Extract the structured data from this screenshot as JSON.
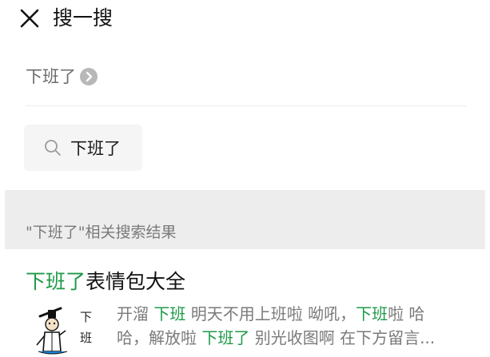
{
  "header": {
    "title": "搜一搜",
    "close_icon": "close-icon"
  },
  "query": {
    "text": "下班了",
    "arrow_icon": "chevron-right-icon"
  },
  "search_chip": {
    "icon": "search-icon",
    "text": "下班了"
  },
  "related": {
    "label": "\"下班了\"相关搜索结果"
  },
  "result": {
    "title_highlight": "下班了",
    "title_rest": "表情包大全",
    "thumbnail_chars": [
      "下",
      "班"
    ],
    "snippet": {
      "line1": [
        {
          "text": "开溜 ",
          "hl": false
        },
        {
          "text": "下班",
          "hl": true
        },
        {
          "text": " 明天不用上班啦 呦吼，",
          "hl": false
        },
        {
          "text": "下班",
          "hl": true
        },
        {
          "text": "啦 哈",
          "hl": false
        }
      ],
      "line2": [
        {
          "text": "哈，解放啦 ",
          "hl": false
        },
        {
          "text": "下班了",
          "hl": true
        },
        {
          "text": " 别光收图啊 在下方留言...",
          "hl": false
        }
      ]
    }
  },
  "colors": {
    "highlight": "#1f9a48",
    "muted_text": "#7a7a7a",
    "band": "#ededed",
    "chip_bg": "#f5f5f5"
  }
}
